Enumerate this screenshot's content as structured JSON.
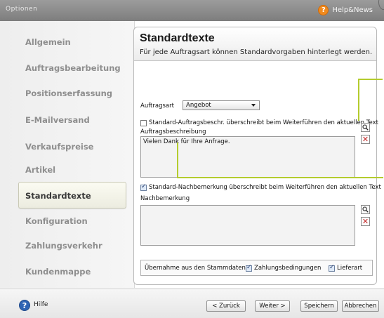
{
  "window": {
    "title": "Optionen"
  },
  "help_news": {
    "label": "Help&News"
  },
  "sidebar": {
    "items": [
      {
        "label": "Allgemein"
      },
      {
        "label": "Auftragsbearbeitung"
      },
      {
        "label": "Positionserfassung"
      },
      {
        "label": "E-Mailversand"
      },
      {
        "label": "Verkaufspreise"
      },
      {
        "label": "Artikel"
      },
      {
        "label": "Standardtexte"
      },
      {
        "label": "Konfiguration"
      },
      {
        "label": "Zahlungsverkehr"
      },
      {
        "label": "Kundenmappe"
      }
    ],
    "active": "Standardtexte"
  },
  "panel": {
    "title": "Standardtexte",
    "subtitle": "Für jede Auftragsart können Standardvorgaben hinterlegt werden.",
    "auftragsart_label": "Auftragsart",
    "auftragsart_value": "Angebot",
    "cb1_label": "Standard-Auftragsbeschr. überschreibt beim Weiterführen den aktuellen Text",
    "cb1_checked": false,
    "beschreibung_label": "Auftragsbeschreibung",
    "beschreibung_value": "Vielen Dank für Ihre Anfrage.",
    "cb2_label": "Standard-Nachbemerkung überschreibt beim Weiterführen den aktuellen Text",
    "cb2_checked": true,
    "nachbemerkung_label": "Nachbemerkung",
    "nachbemerkung_value": "",
    "uebernahme_label": "Übernahme aus den Stammdaten",
    "zahlung_label": "Zahlungsbedingungen",
    "zahlung_checked": true,
    "lieferart_label": "Lieferart",
    "lieferart_checked": true
  },
  "footer": {
    "hilfe_label": "Hilfe",
    "back_label": "< Zurück",
    "next_label": "Weiter >",
    "save_label": "Speichern",
    "cancel_label": "Abbrechen"
  },
  "colors": {
    "accent_annotation": "#b4cc2e",
    "help_orange": "#f08a1e",
    "help_blue": "#2f64b4",
    "delete_red": "#c32424"
  }
}
